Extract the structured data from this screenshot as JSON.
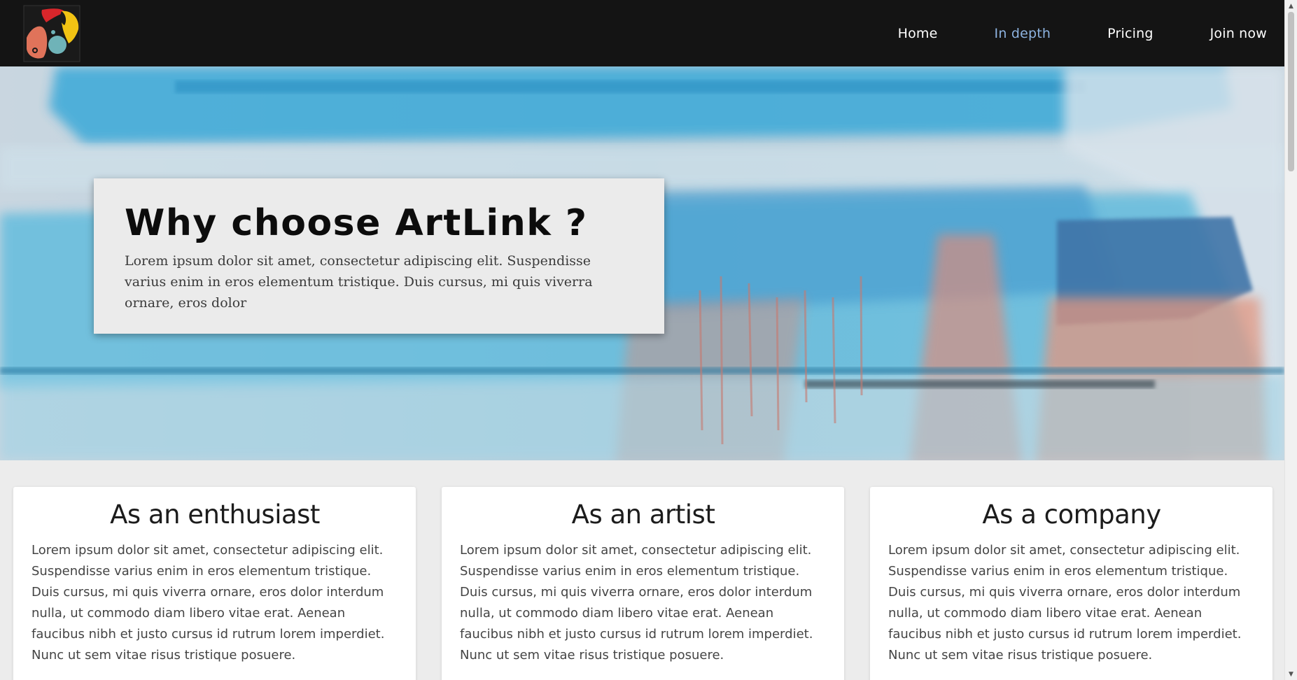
{
  "nav": {
    "logo_alt": "ArtLink logo",
    "links": [
      {
        "label": "Home",
        "active": false
      },
      {
        "label": "In depth",
        "active": true
      },
      {
        "label": "Pricing",
        "active": false
      },
      {
        "label": "Join now",
        "active": false
      }
    ]
  },
  "hero": {
    "title": "Why choose ArtLink ?",
    "text": "Lorem ipsum dolor sit amet, consectetur adipiscing elit. Suspendisse varius enim in eros elementum tristique. Duis cursus, mi quis viverra ornare, eros dolor"
  },
  "cards": [
    {
      "title": "As an enthusiast",
      "text": "Lorem ipsum dolor sit amet, consectetur adipiscing elit. Suspendisse varius enim in eros elementum tristique. Duis cursus, mi quis viverra ornare, eros dolor interdum nulla, ut commodo diam libero vitae erat. Aenean faucibus nibh et justo cursus id rutrum lorem imperdiet. Nunc ut sem vitae risus tristique posuere."
    },
    {
      "title": "As an artist",
      "text": "Lorem ipsum dolor sit amet, consectetur adipiscing elit. Suspendisse varius enim in eros elementum tristique. Duis cursus, mi quis viverra ornare, eros dolor interdum nulla, ut commodo diam libero vitae erat. Aenean faucibus nibh et justo cursus id rutrum lorem imperdiet. Nunc ut sem vitae risus tristique posuere."
    },
    {
      "title": "As a company",
      "text": "Lorem ipsum dolor sit amet, consectetur adipiscing elit. Suspendisse varius enim in eros elementum tristique. Duis cursus, mi quis viverra ornare, eros dolor interdum nulla, ut commodo diam libero vitae erat. Aenean faucibus nibh et justo cursus id rutrum lorem imperdiet. Nunc ut sem vitae risus tristique posuere."
    }
  ],
  "colors": {
    "nav_bg": "#141414",
    "nav_active": "#8db3e0",
    "page_bg": "#ececec",
    "card_bg": "#ffffff",
    "hero_card_bg": "#ebebeb"
  }
}
